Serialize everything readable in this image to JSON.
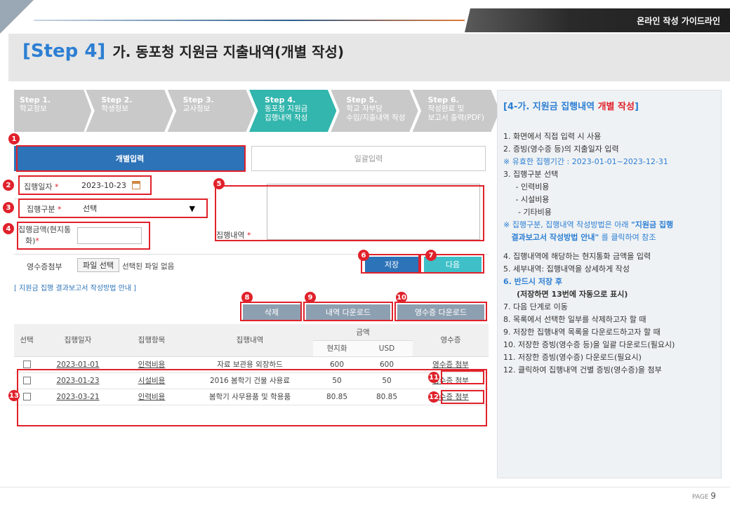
{
  "header": {
    "guideline": "온라인 작성 가이드라인",
    "title_step": "[Step 4]",
    "title_main": "가. 동포청 지원금 지출내역(개별 작성)"
  },
  "steps": [
    {
      "num": "Step 1.",
      "l1": "학교정보",
      "l2": ""
    },
    {
      "num": "Step 2.",
      "l1": "학생정보",
      "l2": ""
    },
    {
      "num": "Step 3.",
      "l1": "교사정보",
      "l2": ""
    },
    {
      "num": "Step 4.",
      "l1": "동포청 지원금",
      "l2": "집행내역 작성"
    },
    {
      "num": "Step 5.",
      "l1": "학교 자부담",
      "l2": "수입/지출내역 작성"
    },
    {
      "num": "Step 6.",
      "l1": "작성완료 및",
      "l2": "보고서 출력(PDF)"
    }
  ],
  "tabs": {
    "individual": "개별입력",
    "bulk": "일괄입력"
  },
  "form": {
    "date_label": "집행일자",
    "date_value": "2023-10-23",
    "category_label": "집행구분",
    "category_value": "선택",
    "amount_label_1": "집행금액(현지통",
    "amount_label_2": "화)",
    "details_label": "집행내역",
    "receipt_label": "영수증첨부",
    "file_button": "파일 선택",
    "file_none": "선택된 파일 없음",
    "required_mark": "*"
  },
  "buttons": {
    "save": "저장",
    "next": "다음",
    "delete": "삭제",
    "download_list": "내역 다운로드",
    "download_receipts": "영수증 다운로드"
  },
  "guide_link": "[ 지원금 집행 결과보고서 작성방법 안내 ]",
  "badges": [
    "1",
    "2",
    "3",
    "4",
    "5",
    "6",
    "7",
    "8",
    "9",
    "10",
    "11",
    "12",
    "13"
  ],
  "table": {
    "headers": {
      "select": "선택",
      "date": "집행일자",
      "item": "집행항목",
      "detail": "집행내역",
      "amount": "금액",
      "local": "현지화",
      "usd": "USD",
      "receipt": "영수증"
    },
    "rows": [
      {
        "date": "2023-01-01",
        "item": "인력비용",
        "detail": "자료 보관용 외장하드",
        "local": "600",
        "usd": "600",
        "receipt": "영수증 첨부"
      },
      {
        "date": "2023-01-23",
        "item": "시설비용",
        "detail": "2016 봄학기 건물 사용료",
        "local": "50",
        "usd": "50",
        "receipt": "영수증 첨부"
      },
      {
        "date": "2023-03-21",
        "item": "인력비용",
        "detail": "봄학기 사무용품 및 학용품",
        "local": "80.85",
        "usd": "80.85",
        "receipt": "영수증 첨부"
      }
    ]
  },
  "panel": {
    "title_a": "[4-가. 지원금 집행내역 ",
    "title_b": "개별 작성",
    "title_c": "]",
    "l1": "1.  화면에서 직접 입력 시 사용",
    "l2": "2.  증빙(영수증 등)의 지출일자 입력",
    "l3": "※ 유효한 집행기간 : 2023-01-01~2023-12-31",
    "l4": "3.   집행구분 선택",
    "l5": "     - 인력비용",
    "l6": "     - 시설비용",
    "l7": "      - 기타비용",
    "l8a": "※ 집행구분, 집행내역 작성방법은 아래 ",
    "l8b": "\"지원금 집행",
    "l9a": "   결과보고서 작성방법 안내\"",
    "l9b": " 를 클릭하여 참조",
    "l10": "4.  집행내역에 해당하는 현지통화 금액을 입력",
    "l11": "5.  세부내역: 집행내역을 상세하게 작성",
    "l12": "6.  반드시 저장 후",
    "l13": "     (저장하면 13번에 자동으로 표시)",
    "l14": "7.  다음 단계로 이동",
    "l15": "8.  목록에서 선택한 일부를 삭제하고자 할 때",
    "l16": "9.  저장한 집행내역 목록을 다운로드하고자 할 때",
    "l17": "10. 저장한 증빙(영수증 등)을 일괄 다운로드(필요시)",
    "l18": "11. 저장한 증빙(영수증) 다운로드(필요시)",
    "l19": "12. 클릭하여 집행내역 건별 증빙(영수증)을 첨부"
  },
  "footer": {
    "page_label": "PAGE",
    "page_num": "9"
  }
}
